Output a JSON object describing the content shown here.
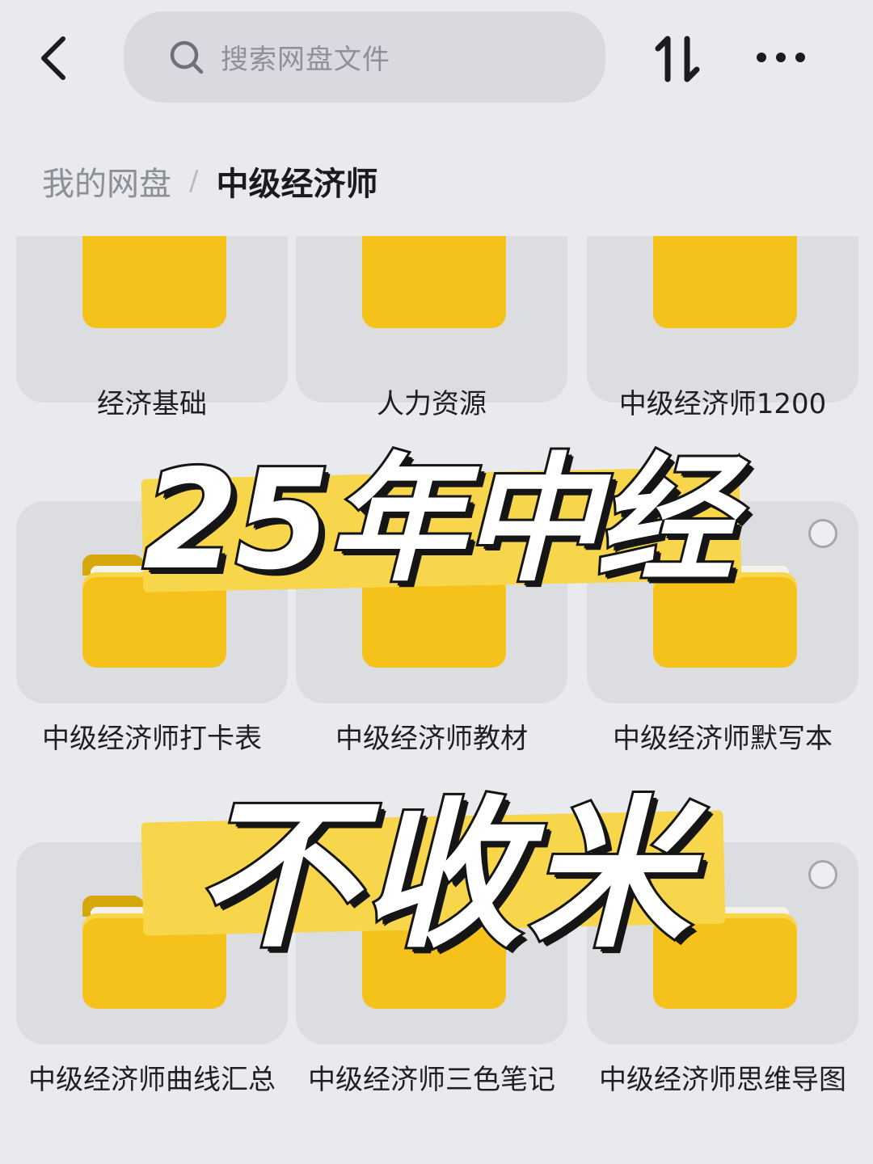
{
  "header": {
    "search_placeholder": "搜索网盘文件",
    "back_icon": "chevron-left-icon",
    "sort_icon": "sort-arrows-icon",
    "more_icon": "more-dots-icon"
  },
  "breadcrumb": {
    "root": "我的网盘",
    "separator": "/",
    "current": "中级经济师"
  },
  "folders": [
    {
      "name": "经济基础"
    },
    {
      "name": "人力资源"
    },
    {
      "name": "中级经济师1200"
    },
    {
      "name": "中级经济师打卡表"
    },
    {
      "name": "中级经济师教材"
    },
    {
      "name": "中级经济师默写本"
    },
    {
      "name": "中级经济师曲线汇总"
    },
    {
      "name": "中级经济师三色笔记"
    },
    {
      "name": "中级经济师思维导图"
    }
  ],
  "overlay": {
    "line1": "25年中经",
    "line2": "不收米",
    "highlight_color": "#f8d64c"
  },
  "colors": {
    "folder_yellow": "#f4c21a",
    "background": "#e9eaee"
  }
}
